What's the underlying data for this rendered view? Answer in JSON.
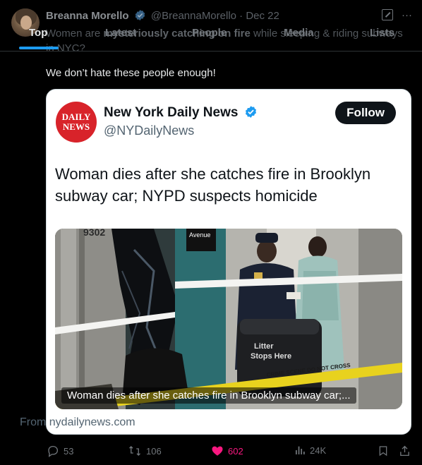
{
  "author": {
    "name": "Breanna Morello",
    "handle": "@BreannaMorello",
    "date": "· Dec 22"
  },
  "tabs": [
    {
      "label": "Top",
      "active": true
    },
    {
      "label": "Latest"
    },
    {
      "label": "People"
    },
    {
      "label": "Media"
    },
    {
      "label": "Lists"
    }
  ],
  "overlap_text": {
    "line1_a": "Women are ",
    "line1_b": "mysteriously catching on fire",
    "line1_c": " while sleeping & riding subways",
    "line2": "in NYC?"
  },
  "post_text": "We don’t hate these people enough!",
  "quoted": {
    "logo_line1": "DAILY",
    "logo_line2": "NEWS",
    "name": "New York Daily News",
    "handle": "@NYDailyNews",
    "follow_label": "Follow",
    "headline": "Woman dies after she catches fire in Brooklyn subway car; NYPD suspects homicide",
    "photo_caption": "Woman dies after she catches fire in Brooklyn subway car;...",
    "photo_signs": {
      "station": "Avenue",
      "car_number": "9302",
      "litter_1": "Litter",
      "litter_2": "Stops Here",
      "tape": "CRIME SCENE DO NOT CROSS"
    },
    "source": "From nydailynews.com"
  },
  "actions": {
    "replies": "53",
    "reposts": "106",
    "likes": "602",
    "views": "24K"
  },
  "colors": {
    "accent": "#1d9bf0",
    "like": "#f91880",
    "muted": "#71767b",
    "logo_red": "#d8232a"
  }
}
